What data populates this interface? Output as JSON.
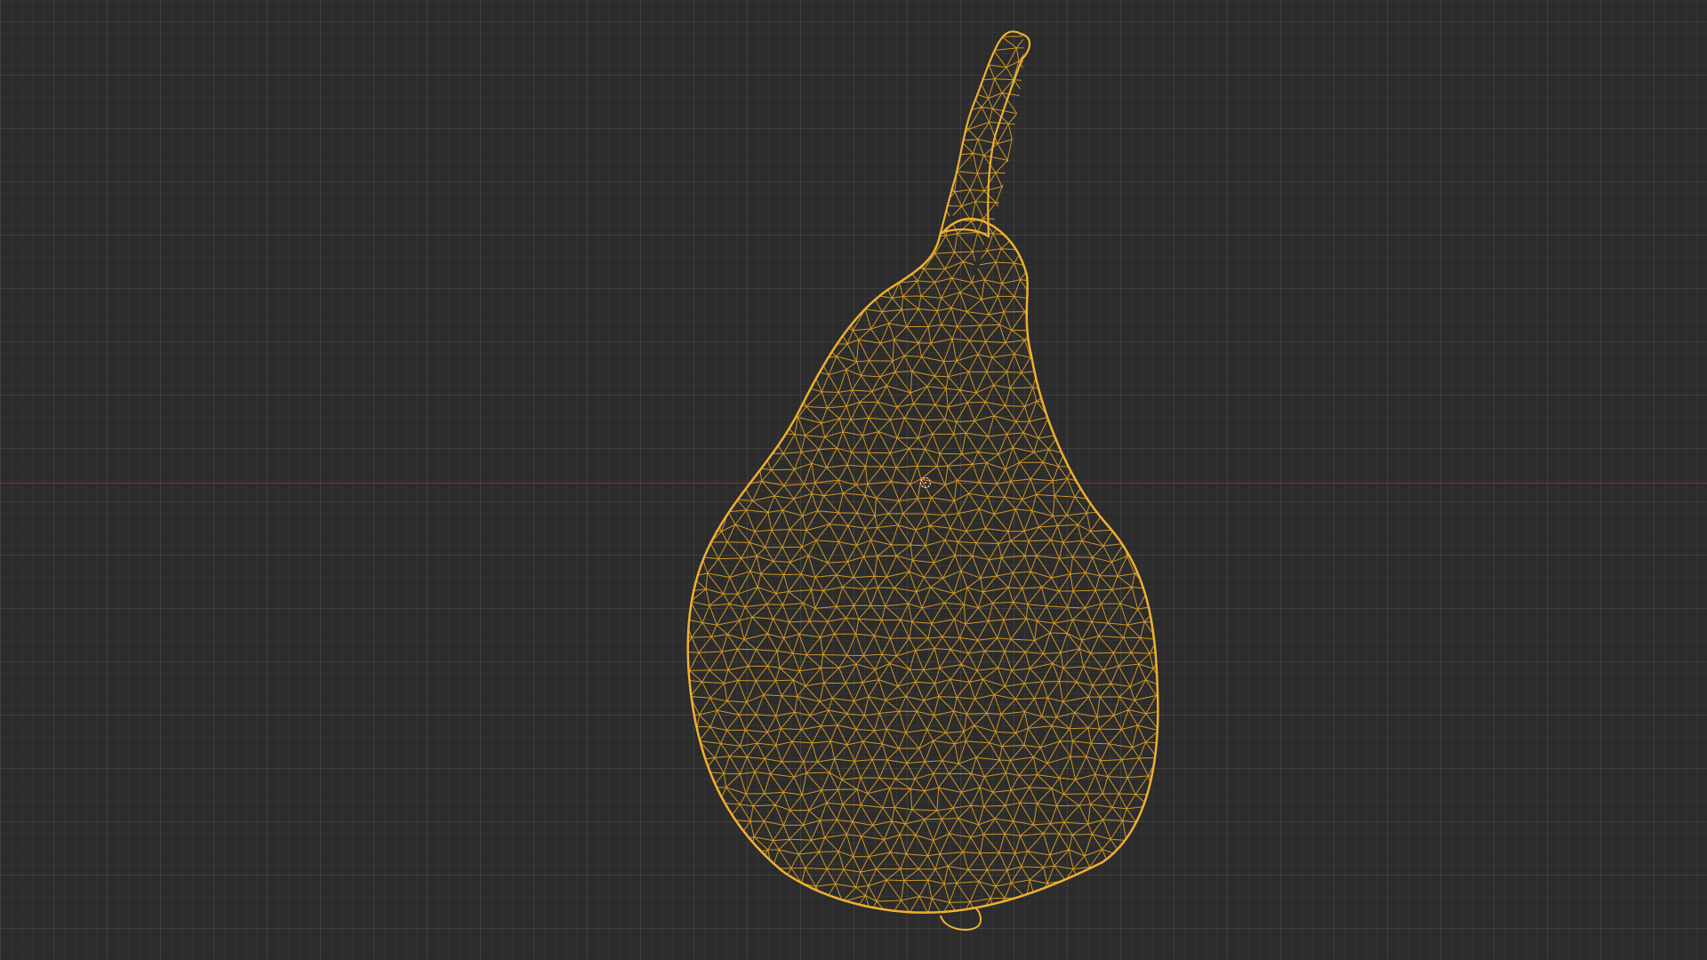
{
  "viewport": {
    "background": "#2c2c2c",
    "grid_color": "#3a3a3a",
    "x_axis_color": "#8a3b3b"
  },
  "object": {
    "icon": "pear-mesh-wireframe",
    "wire_color": "#e0a222",
    "outline_color": "#f0b030"
  },
  "cursor": {
    "icon": "3d-cursor-icon"
  }
}
